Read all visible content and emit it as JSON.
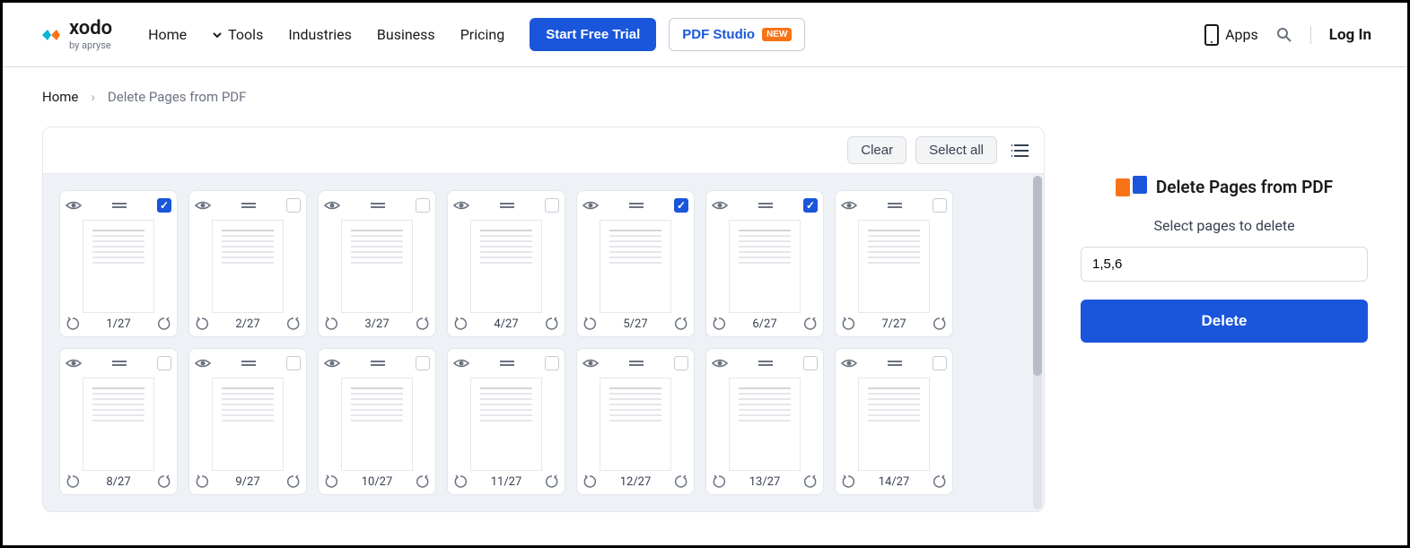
{
  "brand": {
    "name": "xodo",
    "sub": "by apryse"
  },
  "nav": {
    "home": "Home",
    "tools": "Tools",
    "industries": "Industries",
    "business": "Business",
    "pricing": "Pricing"
  },
  "cta": {
    "trial": "Start Free Trial",
    "studio": "PDF Studio",
    "badge": "NEW"
  },
  "right": {
    "apps": "Apps",
    "login": "Log In"
  },
  "breadcrumb": {
    "home": "Home",
    "current": "Delete Pages from PDF"
  },
  "toolbar": {
    "clear": "Clear",
    "select_all": "Select all"
  },
  "total_pages": 27,
  "pages": [
    {
      "n": 1,
      "label": "1/27",
      "selected": true
    },
    {
      "n": 2,
      "label": "2/27",
      "selected": false
    },
    {
      "n": 3,
      "label": "3/27",
      "selected": false
    },
    {
      "n": 4,
      "label": "4/27",
      "selected": false
    },
    {
      "n": 5,
      "label": "5/27",
      "selected": true
    },
    {
      "n": 6,
      "label": "6/27",
      "selected": true
    },
    {
      "n": 7,
      "label": "7/27",
      "selected": false
    },
    {
      "n": 8,
      "label": "8/27",
      "selected": false
    },
    {
      "n": 9,
      "label": "9/27",
      "selected": false
    },
    {
      "n": 10,
      "label": "10/27",
      "selected": false
    },
    {
      "n": 11,
      "label": "11/27",
      "selected": false
    },
    {
      "n": 12,
      "label": "12/27",
      "selected": false
    },
    {
      "n": 13,
      "label": "13/27",
      "selected": false
    },
    {
      "n": 14,
      "label": "14/27",
      "selected": false
    }
  ],
  "side": {
    "title": "Delete Pages from PDF",
    "subtitle": "Select pages to delete",
    "input_value": "1,5,6",
    "delete_label": "Delete"
  }
}
